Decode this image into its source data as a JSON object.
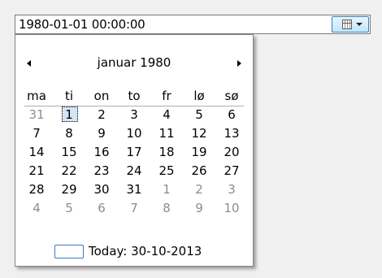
{
  "picker": {
    "value": "1980-01-01 00:00:00",
    "dropdown_icon": "calendar-icon"
  },
  "calendar": {
    "month_title": "januar 1980",
    "prev_icon": "left-triangle",
    "next_icon": "right-triangle",
    "weekdays": [
      "ma",
      "ti",
      "on",
      "to",
      "fr",
      "lø",
      "sø"
    ],
    "weeks": [
      [
        {
          "d": "31",
          "dim": true
        },
        {
          "d": "1",
          "sel": true
        },
        {
          "d": "2"
        },
        {
          "d": "3"
        },
        {
          "d": "4"
        },
        {
          "d": "5"
        },
        {
          "d": "6"
        }
      ],
      [
        {
          "d": "7"
        },
        {
          "d": "8"
        },
        {
          "d": "9"
        },
        {
          "d": "10"
        },
        {
          "d": "11"
        },
        {
          "d": "12"
        },
        {
          "d": "13"
        }
      ],
      [
        {
          "d": "14"
        },
        {
          "d": "15"
        },
        {
          "d": "16"
        },
        {
          "d": "17"
        },
        {
          "d": "18"
        },
        {
          "d": "19"
        },
        {
          "d": "20"
        }
      ],
      [
        {
          "d": "21"
        },
        {
          "d": "22"
        },
        {
          "d": "23"
        },
        {
          "d": "24"
        },
        {
          "d": "25"
        },
        {
          "d": "26"
        },
        {
          "d": "27"
        }
      ],
      [
        {
          "d": "28"
        },
        {
          "d": "29"
        },
        {
          "d": "30"
        },
        {
          "d": "31"
        },
        {
          "d": "1",
          "dim": true
        },
        {
          "d": "2",
          "dim": true
        },
        {
          "d": "3",
          "dim": true
        }
      ],
      [
        {
          "d": "4",
          "dim": true
        },
        {
          "d": "5",
          "dim": true
        },
        {
          "d": "6",
          "dim": true
        },
        {
          "d": "7",
          "dim": true
        },
        {
          "d": "8",
          "dim": true
        },
        {
          "d": "9",
          "dim": true
        },
        {
          "d": "10",
          "dim": true
        }
      ]
    ],
    "today_label": "Today: 30-10-2013"
  },
  "colors": {
    "background": "#f0f0f0",
    "selected_fill": "#d5e4f2",
    "dim_text": "#8d8d8d",
    "today_border": "#3b78c4"
  }
}
